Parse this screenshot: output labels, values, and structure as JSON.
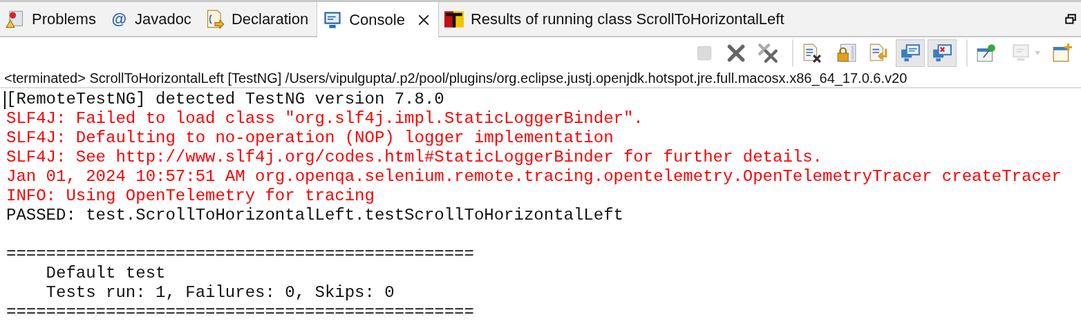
{
  "tabs": [
    {
      "label": "Problems",
      "kind": "problems",
      "selected": false
    },
    {
      "label": "Javadoc",
      "kind": "javadoc",
      "icon_text": "@",
      "selected": false
    },
    {
      "label": "Declaration",
      "kind": "declaration",
      "selected": false
    },
    {
      "label": "Console",
      "kind": "console",
      "selected": true
    },
    {
      "label": "Results of running class ScrollToHorizontalLeft",
      "kind": "testng",
      "selected": false
    }
  ],
  "toolbar": [
    {
      "kind": "stop",
      "selected": false,
      "disabled": true,
      "separator_before": false
    },
    {
      "kind": "remove",
      "selected": false,
      "disabled": false,
      "separator_before": false
    },
    {
      "kind": "remove-all",
      "selected": false,
      "disabled": false,
      "separator_before": false
    },
    {
      "kind": "clear",
      "selected": false,
      "disabled": false,
      "separator_before": true
    },
    {
      "kind": "scroll-lock",
      "selected": false,
      "disabled": false,
      "separator_before": false
    },
    {
      "kind": "word-wrap",
      "selected": false,
      "disabled": false,
      "separator_before": false
    },
    {
      "kind": "show-out",
      "selected": true,
      "disabled": false,
      "separator_before": false
    },
    {
      "kind": "show-err",
      "selected": true,
      "disabled": false,
      "separator_before": false
    },
    {
      "kind": "pin",
      "selected": false,
      "disabled": false,
      "separator_before": true
    },
    {
      "kind": "display",
      "selected": false,
      "disabled": true,
      "separator_before": false
    },
    {
      "kind": "new-console",
      "selected": false,
      "disabled": false,
      "separator_before": false
    }
  ],
  "process_label": "<terminated> ScrollToHorizontalLeft [TestNG] /Users/vipulgupta/.p2/pool/plugins/org.eclipse.justj.openjdk.hotspot.jre.full.macosx.x86_64_17.0.6.v20",
  "console_lines": [
    {
      "kind": "out",
      "text": "[RemoteTestNG] detected TestNG version 7.8.0"
    },
    {
      "kind": "err",
      "text": "SLF4J: Failed to load class \"org.slf4j.impl.StaticLoggerBinder\"."
    },
    {
      "kind": "err",
      "text": "SLF4J: Defaulting to no-operation (NOP) logger implementation"
    },
    {
      "kind": "err",
      "text": "SLF4J: See http://www.slf4j.org/codes.html#StaticLoggerBinder for further details."
    },
    {
      "kind": "err",
      "text": "Jan 01, 2024 10:57:51 AM org.openqa.selenium.remote.tracing.opentelemetry.OpenTelemetryTracer createTracer"
    },
    {
      "kind": "err",
      "text": "INFO: Using OpenTelemetry for tracing"
    },
    {
      "kind": "out",
      "text": "PASSED: test.ScrollToHorizontalLeft.testScrollToHorizontalLeft"
    },
    {
      "kind": "blank"
    },
    {
      "kind": "out",
      "text": "==============================================="
    },
    {
      "kind": "out",
      "text": "    Default test"
    },
    {
      "kind": "out",
      "text": "    Tests run: 1, Failures: 0, Skips: 0"
    },
    {
      "kind": "out",
      "text": "==============================================="
    }
  ]
}
